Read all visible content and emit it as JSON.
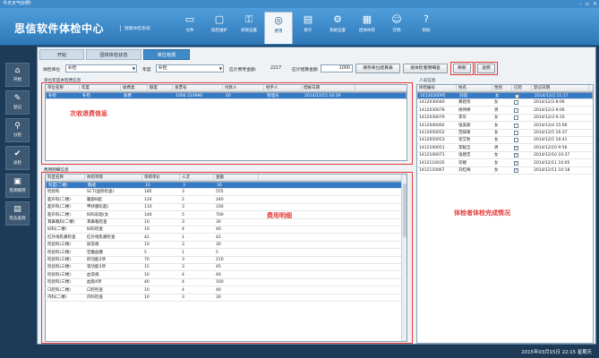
{
  "window": {
    "title": "今天天气好啊!"
  },
  "header": {
    "brand": "思信软件体检中心",
    "subtitle": "健康体检系统",
    "toolbar": [
      {
        "label": "文件",
        "icon": "file-icon",
        "glyph": "▭"
      },
      {
        "label": "批检维护",
        "icon": "monitor-icon",
        "glyph": "▢"
      },
      {
        "label": "权限设置",
        "icon": "lock-icon",
        "glyph": "⚿"
      },
      {
        "label": "费用",
        "icon": "money-icon",
        "glyph": "◎",
        "active": true
      },
      {
        "label": "统计",
        "icon": "chart-icon",
        "glyph": "▤"
      },
      {
        "label": "系统设置",
        "icon": "gear-icon",
        "glyph": "⚙"
      },
      {
        "label": "团体体检",
        "icon": "building-icon",
        "glyph": "▦"
      },
      {
        "label": "在网",
        "icon": "user-icon",
        "glyph": "☺"
      },
      {
        "label": "帮助",
        "icon": "help-icon",
        "glyph": "?"
      }
    ]
  },
  "sidebar": {
    "items": [
      {
        "label": "开始",
        "icon": "home-icon",
        "glyph": "⌂"
      },
      {
        "label": "登记",
        "icon": "register-icon",
        "glyph": "✎"
      },
      {
        "label": "分检",
        "icon": "search-icon",
        "glyph": "⚲"
      },
      {
        "label": "总检",
        "icon": "check-icon",
        "glyph": "✔"
      },
      {
        "label": "检测報到",
        "icon": "report-icon",
        "glyph": "▣"
      },
      {
        "label": "检态查到",
        "icon": "status-icon",
        "glyph": "▤"
      }
    ]
  },
  "tabs": [
    {
      "label": "开始"
    },
    {
      "label": "团体体检状态"
    },
    {
      "label": "单位核费",
      "active": true
    }
  ],
  "filter": {
    "unit_label": "体检单位",
    "unit_value": "补检",
    "year_label": "年度",
    "year_value": "补检",
    "total_amount_label": "应计费考金额:",
    "total_amount_value": "2217",
    "total_settle_label": "应计结算金额",
    "total_settle_value": "1000",
    "btn_save": "保存单位结算表",
    "btn_query": "按体检者明细查",
    "btn_refresh": "刷新",
    "btn_exit": "退费"
  },
  "unit_panel": {
    "title": "单位年度本检费信息",
    "columns": [
      "单位名称",
      "年度",
      "收费类",
      "额度",
      "发票号",
      "付款人",
      "经手人",
      "结帐日期"
    ],
    "rows": [
      [
        "补检",
        "补检",
        "收费",
        "",
        "1000 333996",
        "00",
        "管理员",
        "2014/12/15 16:29"
      ]
    ],
    "annotation": "次收退费信息"
  },
  "fee_panel": {
    "title": "费用明细信息",
    "columns": [
      "科室名称",
      "体检项目",
      "项目单价",
      "人次",
      "金额"
    ],
    "rows": [
      [
        "科室(二楼)",
        "胸透",
        "10",
        "3",
        "30"
      ],
      [
        "检验科",
        "SCT(国际检查)",
        "185",
        "3",
        "555"
      ],
      [
        "超声科(二楼)",
        "腹部B超",
        "120",
        "2",
        "240"
      ],
      [
        "超声科(二楼)",
        "甲状腺彩超(",
        "110",
        "3",
        "330"
      ],
      [
        "超声科(二楼)",
        "妇科彩超(女",
        "140",
        "5",
        "700"
      ],
      [
        "耳鼻喉科(二楼)",
        "耳鼻喉检查",
        "10",
        "3",
        "30"
      ],
      [
        "妇科(二楼)",
        "妇科检查",
        "10",
        "4",
        "40"
      ],
      [
        "红外线乳腺检查",
        "红外线乳腺检查",
        "42",
        "1",
        "42"
      ],
      [
        "检验科(三楼)",
        "尿常规",
        "10",
        "3",
        "30"
      ],
      [
        "检验科(三楼)",
        "空腹血糖",
        "5",
        "1",
        "5"
      ],
      [
        "检验科(三楼)",
        "肝功能3项",
        "70",
        "3",
        "210"
      ],
      [
        "检验科(三楼)",
        "肾功能3项",
        "15",
        "3",
        "45"
      ],
      [
        "检验科(三楼)",
        "血常规",
        "10",
        "4",
        "40"
      ],
      [
        "检验科(三楼)",
        "血脂4项",
        "40",
        "4",
        "160"
      ],
      [
        "口腔科(二楼)",
        "口腔检查",
        "10",
        "4",
        "40"
      ],
      [
        "内科(二楼)",
        "内科检查",
        "10",
        "3",
        "30"
      ]
    ],
    "annotation": "费用明细"
  },
  "people_panel": {
    "title": "人员信息",
    "columns": [
      "体检编号",
      "姓名",
      "性别",
      "已检",
      "登记日期"
    ],
    "rows": [
      [
        "1412020095",
        "刘琪",
        "女",
        "☑",
        "2014/12/2 11:17"
      ],
      [
        "1412030040",
        "黄碧英",
        "女",
        "☐",
        "2014/12/3 8:06"
      ],
      [
        "1412030078",
        "杨伟婷",
        "男",
        "☐",
        "2014/12/3 9:06"
      ],
      [
        "1412030079",
        "李华",
        "女",
        "☐",
        "2014/12/3 9:10"
      ],
      [
        "1412040092",
        "张美丽",
        "女",
        "☐",
        "2014/12/4 15:06"
      ],
      [
        "1412050052",
        "范辞章",
        "女",
        "☐",
        "2014/12/5 16:37"
      ],
      [
        "1412050053",
        "邬艾秋",
        "女",
        "☐",
        "2014/12/5 16:41"
      ],
      [
        "1412100051",
        "李聪洁",
        "男",
        "☑",
        "2014/12/10 9:56"
      ],
      [
        "1412100071",
        "张建忠",
        "女",
        "☑",
        "2014/12/10 10:37"
      ],
      [
        "1412110035",
        "邓婕",
        "女",
        "☑",
        "2014/12/11 10:05"
      ],
      [
        "1412110067",
        "刘红梅",
        "女",
        "☑",
        "2014/12/11 10:18"
      ]
    ],
    "annotation": "体检者体检完成情况"
  },
  "status": {
    "datetime": "2015年03月15日 22:15 星期天"
  },
  "colors": {
    "accent": "#3f89c8",
    "annotation": "#e53935",
    "header_bg": "#2f78b8"
  }
}
